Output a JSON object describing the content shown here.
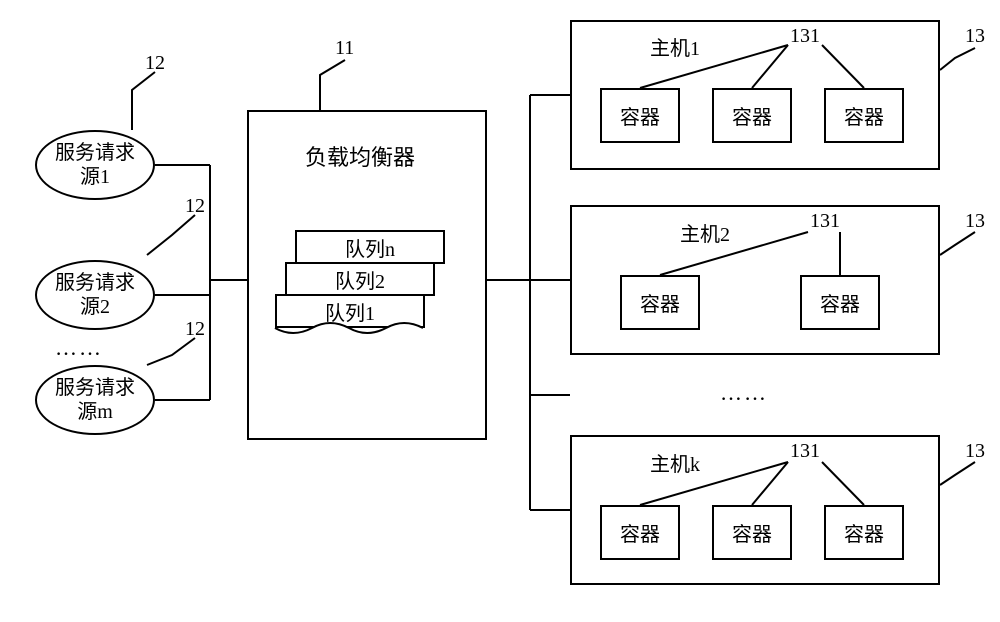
{
  "labels": {
    "lb": "负载均衡器",
    "src1": "服务请求\n源1",
    "src2": "服务请求\n源2",
    "srcm": "服务请求\n源m",
    "queue_n": "队列n",
    "queue_2": "队列2",
    "queue_1": "队列1",
    "host1": "主机1",
    "host2": "主机2",
    "hostk": "主机k",
    "container": "容器",
    "num11": "11",
    "num12": "12",
    "num13": "13",
    "num131": "131",
    "dots": "……"
  },
  "chart_data": {
    "type": "table",
    "description": "System architecture diagram showing load balancing",
    "components": [
      {
        "id": 12,
        "name": "服务请求源",
        "count": "m",
        "instances": [
          "源1",
          "源2",
          "...",
          "源m"
        ]
      },
      {
        "id": 11,
        "name": "负载均衡器",
        "queues": [
          "队列1",
          "队列2",
          "...",
          "队列n"
        ]
      },
      {
        "id": 13,
        "name": "主机",
        "count": "k",
        "instances": [
          {
            "name": "主机1",
            "containers": 3,
            "container_id": 131
          },
          {
            "name": "主机2",
            "containers": 2,
            "container_id": 131
          },
          {
            "name": "主机k",
            "containers": 3,
            "container_id": 131
          }
        ]
      }
    ],
    "connections": [
      {
        "from": "服务请求源1",
        "to": "负载均衡器"
      },
      {
        "from": "服务请求源2",
        "to": "负载均衡器"
      },
      {
        "from": "服务请求源m",
        "to": "负载均衡器"
      },
      {
        "from": "负载均衡器",
        "to": "主机1"
      },
      {
        "from": "负载均衡器",
        "to": "主机2"
      },
      {
        "from": "负载均衡器",
        "to": "主机k"
      }
    ]
  }
}
